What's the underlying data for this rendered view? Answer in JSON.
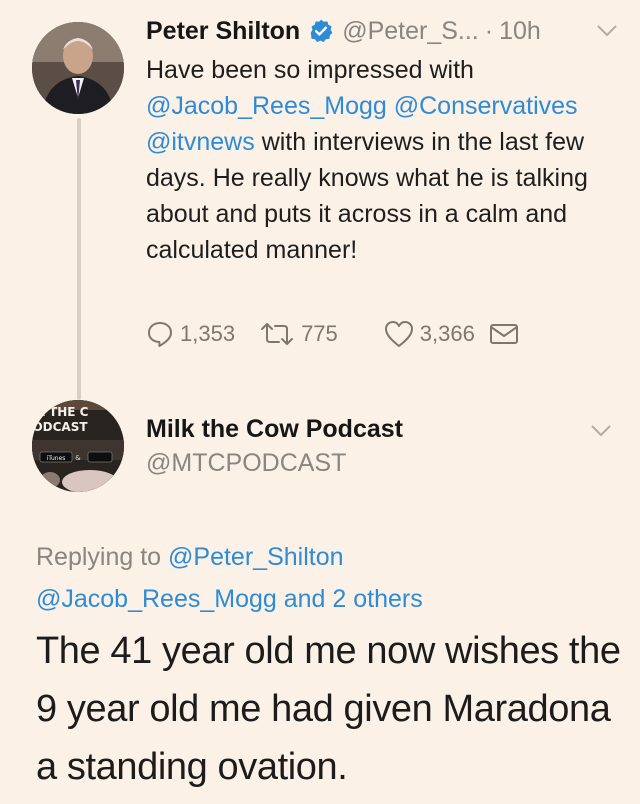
{
  "tweet1": {
    "display_name": "Peter Shilton",
    "handle": "@Peter_S...",
    "separator": "·",
    "time": "10h",
    "body_parts": [
      {
        "text": "Have been so impressed with ",
        "type": "text"
      },
      {
        "text": "@Jacob_Rees_Mogg",
        "type": "mention"
      },
      {
        "text": " ",
        "type": "text"
      },
      {
        "text": "@Conservatives",
        "type": "mention"
      },
      {
        "text": " ",
        "type": "text"
      },
      {
        "text": "@itvnews",
        "type": "mention"
      },
      {
        "text": "  with interviews in the last few days. He really knows what he is talking about and puts it across in a calm and calculated manner!",
        "type": "text"
      }
    ],
    "replies": "1,353",
    "retweets": "775",
    "likes": "3,366"
  },
  "tweet2": {
    "display_name": "Milk the Cow Podcast",
    "handle": "@MTCPODCAST",
    "avatar_text_top": "K THE C",
    "avatar_text_mid": "ODCAST",
    "avatar_badge": "iTunes",
    "reply_prefix": "Replying to",
    "reply_to": "@Peter_Shilton",
    "reply_second": "@Jacob_Rees_Mogg",
    "reply_suffix": "and 2 others",
    "body": "The 41 year old me now wishes the 9 year old me had given Maradona a standing ovation."
  },
  "colors": {
    "background": "#fbf1e6",
    "mention": "#2e8bd6",
    "secondary": "#8a8580",
    "verified": "#2e8bd6"
  }
}
